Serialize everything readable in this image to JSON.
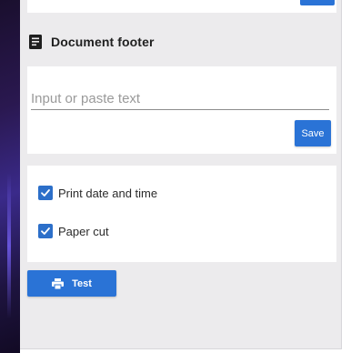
{
  "section": {
    "title": "Document footer",
    "icon": "receipt-icon"
  },
  "footer_input": {
    "value": "",
    "placeholder": "Input or paste text"
  },
  "buttons": {
    "save_label": "Save",
    "test_label": "Test",
    "test_icon": "printer-icon"
  },
  "options": [
    {
      "label": "Print date and time",
      "checked": true
    },
    {
      "label": "Paper cut",
      "checked": true
    }
  ],
  "colors": {
    "accent": "#2a73d6",
    "panel_background": "#ecebed",
    "card_background": "#ffffff",
    "checkbox": "#2c6fc9"
  }
}
